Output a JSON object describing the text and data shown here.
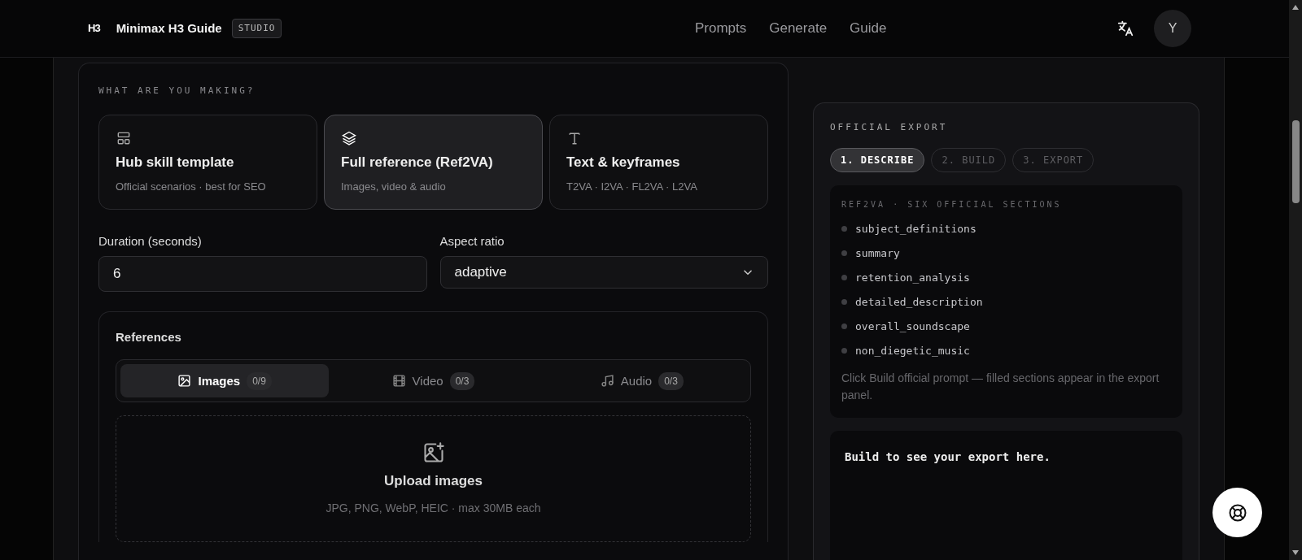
{
  "header": {
    "logo": "H3",
    "title": "Minimax H3 Guide",
    "badge": "STUDIO",
    "nav": [
      {
        "label": "Prompts"
      },
      {
        "label": "Generate"
      },
      {
        "label": "Guide"
      }
    ],
    "avatar": "Y"
  },
  "maker": {
    "heading": "WHAT ARE YOU MAKING?",
    "options": [
      {
        "title": "Hub skill template",
        "subtitle": "Official scenarios · best for SEO",
        "selected": false
      },
      {
        "title": "Full reference (Ref2VA)",
        "subtitle": "Images, video & audio",
        "selected": true
      },
      {
        "title": "Text & keyframes",
        "subtitle": "T2VA · I2VA · FL2VA · L2VA",
        "selected": false
      }
    ]
  },
  "duration": {
    "label": "Duration (seconds)",
    "value": "6"
  },
  "aspect_ratio": {
    "label": "Aspect ratio",
    "value": "adaptive"
  },
  "references": {
    "title": "References",
    "tabs": [
      {
        "label": "Images",
        "count": "0/9",
        "selected": true
      },
      {
        "label": "Video",
        "count": "0/3",
        "selected": false
      },
      {
        "label": "Audio",
        "count": "0/3",
        "selected": false
      }
    ],
    "upload": {
      "title": "Upload images",
      "hint": "JPG, PNG, WebP, HEIC · max 30MB each"
    }
  },
  "export": {
    "heading": "OFFICIAL EXPORT",
    "steps": [
      {
        "label": "1. DESCRIBE",
        "selected": true
      },
      {
        "label": "2. BUILD",
        "selected": false
      },
      {
        "label": "3. EXPORT",
        "selected": false
      }
    ],
    "sections_heading": "REF2VA · SIX OFFICIAL SECTIONS",
    "sections": [
      "subject_definitions",
      "summary",
      "retention_analysis",
      "detailed_description",
      "overall_soundscape",
      "non_diegetic_music"
    ],
    "note": "Click Build official prompt — filled sections appear in the export panel.",
    "output": "Build to see your export here."
  }
}
